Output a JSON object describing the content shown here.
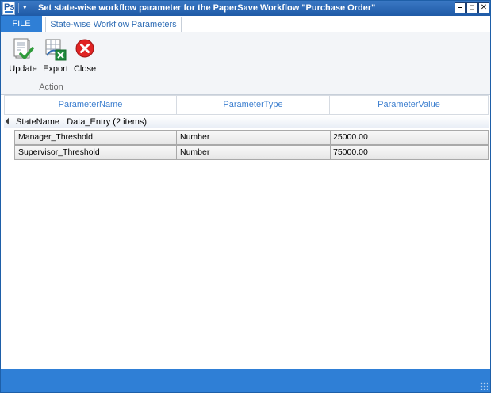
{
  "window": {
    "title": "Set state-wise workflow parameter for the PaperSave Workflow \"Purchase Order\"",
    "app_icon_text": "Ps",
    "min_glyph": "–",
    "max_glyph": "□",
    "close_glyph": "✕",
    "qat_dropdown_glyph": "▾"
  },
  "ribbon": {
    "file_tab": "FILE",
    "active_tab": "State-wise Workflow Parameters",
    "group_label": "Action",
    "buttons": {
      "update": "Update",
      "export": "Export",
      "close": "Close"
    }
  },
  "grid": {
    "columns": [
      "ParameterName",
      "ParameterType",
      "ParameterValue"
    ],
    "group_header": "StateName : Data_Entry (2 items)",
    "rows": [
      {
        "name": "Manager_Threshold",
        "type": "Number",
        "value": "25000.00"
      },
      {
        "name": "Supervisor_Threshold",
        "type": "Number",
        "value": "75000.00"
      }
    ]
  },
  "colors": {
    "title_bar": "#1f5aa6",
    "accent": "#2f7fd6",
    "header_text": "#3d7fcf"
  }
}
